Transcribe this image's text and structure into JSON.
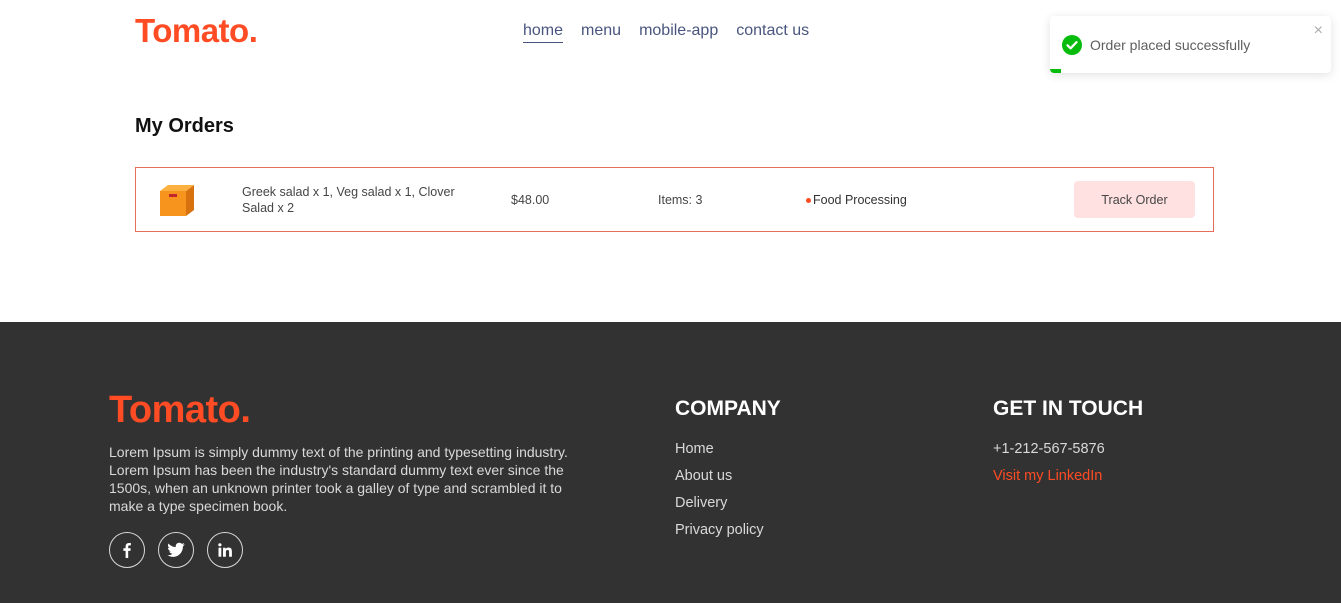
{
  "navbar": {
    "logo": "Tomato.",
    "items": [
      {
        "label": "home",
        "active": true
      },
      {
        "label": "menu",
        "active": false
      },
      {
        "label": "mobile-app",
        "active": false
      },
      {
        "label": "contact us",
        "active": false
      }
    ]
  },
  "toast": {
    "message": "Order placed successfully",
    "close_glyph": "×",
    "icon": "check-circle-icon",
    "color": "#07bc0c"
  },
  "orders": {
    "title": "My Orders",
    "rows": [
      {
        "icon": "parcel-icon",
        "items": "Greek salad x 1, Veg salad x 1, Clover Salad x 2",
        "amount": "$48.00",
        "count": "Items: 3",
        "status": "Food Processing",
        "action": "Track Order"
      }
    ]
  },
  "footer": {
    "logo": "Tomato.",
    "description": "Lorem Ipsum is simply dummy text of the printing and typesetting industry. Lorem Ipsum has been the industry's standard dummy text ever since the 1500s, when an unknown printer took a galley of type and scrambled it to make a type specimen book.",
    "socials": [
      "facebook-icon",
      "twitter-icon",
      "linkedin-icon"
    ],
    "company": {
      "heading": "COMPANY",
      "links": [
        "Home",
        "About us",
        "Delivery",
        "Privacy policy"
      ]
    },
    "contact": {
      "heading": "GET IN TOUCH",
      "phone": "+1-212-567-5876",
      "linkedin": "Visit my LinkedIn"
    }
  },
  "colors": {
    "brand": "#ff4c24",
    "footer_bg": "#323232",
    "track_button_bg": "#ffe1e1",
    "order_border": "#e66f5a"
  }
}
